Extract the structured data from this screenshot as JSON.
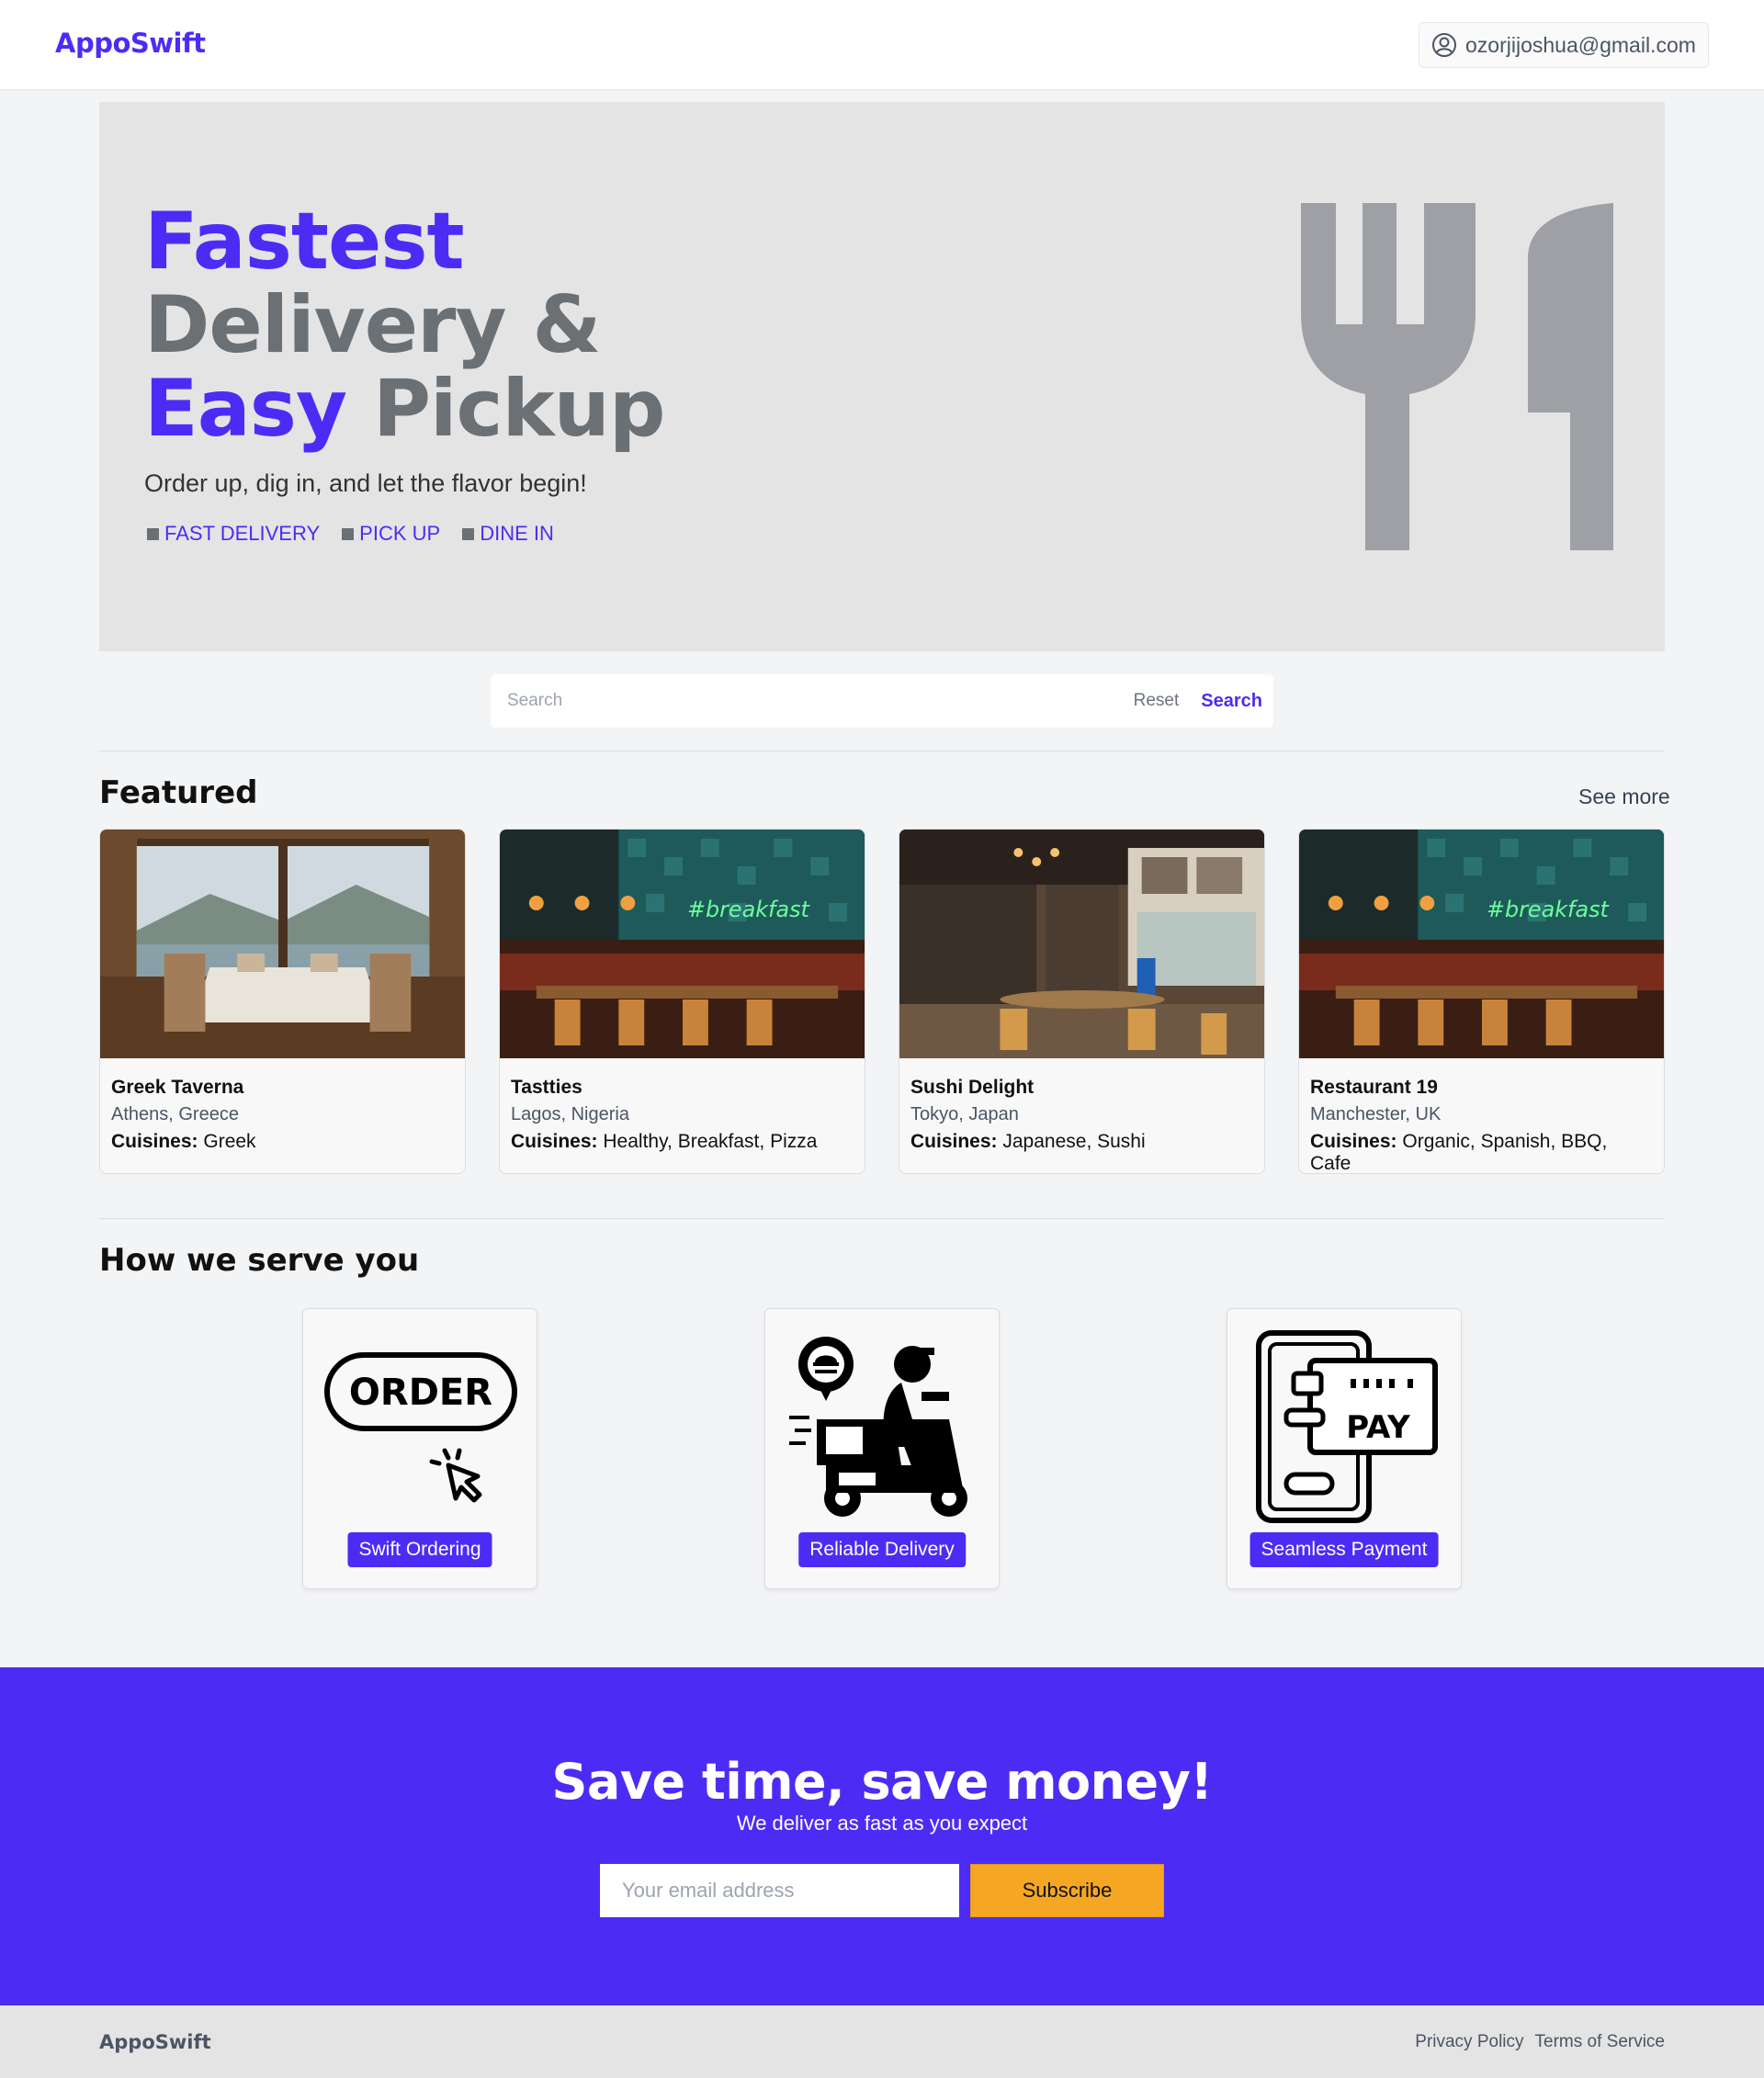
{
  "nav": {
    "brand": "AppoSwift",
    "user_email": "ozorjijoshua@gmail.com"
  },
  "hero": {
    "line1": "Fastest",
    "line2": "Delivery &",
    "line3a": "Easy",
    "line3b": "Pickup",
    "subtitle": "Order up, dig in, and let the flavor begin!",
    "tags": [
      "FAST DELIVERY",
      "PICK UP",
      "DINE IN"
    ]
  },
  "search": {
    "placeholder": "Search",
    "reset_label": "Reset",
    "search_label": "Search"
  },
  "featured": {
    "title": "Featured",
    "see_more": "See more",
    "cuisines_label": "Cuisines:",
    "items": [
      {
        "name": "Greek Taverna",
        "location": "Athens, Greece",
        "cuisines": "Greek"
      },
      {
        "name": "Tastties",
        "location": "Lagos, Nigeria",
        "cuisines": "Healthy, Breakfast, Pizza"
      },
      {
        "name": "Sushi Delight",
        "location": "Tokyo, Japan",
        "cuisines": "Japanese, Sushi"
      },
      {
        "name": "Restaurant 19",
        "location": "Manchester, UK",
        "cuisines": "Organic, Spanish, BBQ, Cafe"
      }
    ]
  },
  "serve": {
    "title": "How we serve you",
    "items": [
      {
        "label": "Swift Ordering",
        "icon": "order-icon",
        "icon_text": "ORDER"
      },
      {
        "label": "Reliable Delivery",
        "icon": "delivery-scooter-icon"
      },
      {
        "label": "Seamless Payment",
        "icon": "pay-icon",
        "icon_text": "PAY"
      }
    ]
  },
  "cta": {
    "title": "Save time, save money!",
    "subtitle": "We deliver as fast as you expect",
    "email_placeholder": "Your email address",
    "subscribe_label": "Subscribe"
  },
  "footer": {
    "brand": "AppoSwift",
    "privacy": "Privacy Policy",
    "terms": "Terms of Service"
  },
  "colors": {
    "accent": "#4c2cf5",
    "hero_gray": "#6b7075",
    "subscribe": "#f5a623"
  }
}
